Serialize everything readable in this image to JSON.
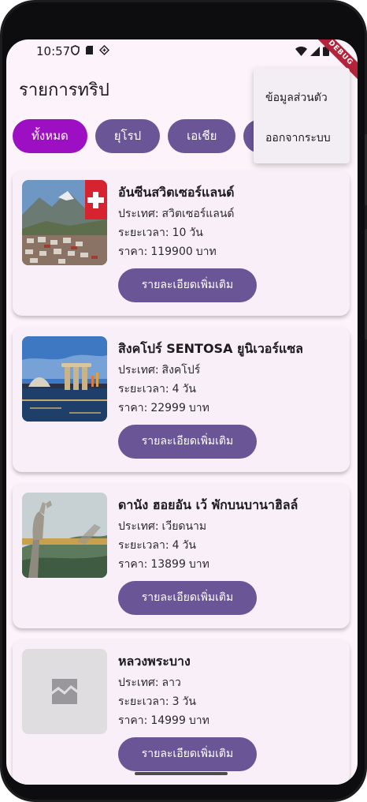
{
  "status_bar": {
    "time": "10:57",
    "debug_label": "DEBUG"
  },
  "app_bar": {
    "title": "รายการทริป"
  },
  "filters": [
    {
      "label": "ทั้งหมด",
      "active": true
    },
    {
      "label": "ยุโรป",
      "active": false
    },
    {
      "label": "เอเชีย",
      "active": false
    },
    {
      "label": "",
      "active": false
    }
  ],
  "menu": {
    "items": [
      {
        "label": "ข้อมูลส่วนตัว"
      },
      {
        "label": "ออกจากระบบ"
      }
    ]
  },
  "labels": {
    "country": "ประเทศ:",
    "duration": "ระยะเวลา:",
    "price": "ราคา:",
    "duration_unit": "วัน",
    "price_unit": "บาท",
    "details_button": "รายละเอียดเพิ่มเติม"
  },
  "trips": [
    {
      "title": "อันซีนสวิตเซอร์แลนด์",
      "country": "สวิตเซอร์แลนด์",
      "duration": "10",
      "price": "119900",
      "image": "switzerland-photo"
    },
    {
      "title": "สิงคโปร์ SENTOSA ยูนิเวอร์แซล",
      "country": "สิงคโปร์",
      "duration": "4",
      "price": "22999",
      "image": "singapore-photo"
    },
    {
      "title": "ดานัง ฮอยอัน เว้ พักบนบานาฮิลล์",
      "country": "เวียดนาม",
      "duration": "4",
      "price": "13899",
      "image": "vietnam-photo"
    },
    {
      "title": "หลวงพระบาง",
      "country": "ลาว",
      "duration": "3",
      "price": "14999",
      "image": "broken-image-icon"
    }
  ],
  "colors": {
    "background": "#fdf3fb",
    "primary": "#6a5597",
    "chip_active": "#9c0fc2",
    "card": "#f8eff8",
    "menu": "#f3edf4"
  }
}
